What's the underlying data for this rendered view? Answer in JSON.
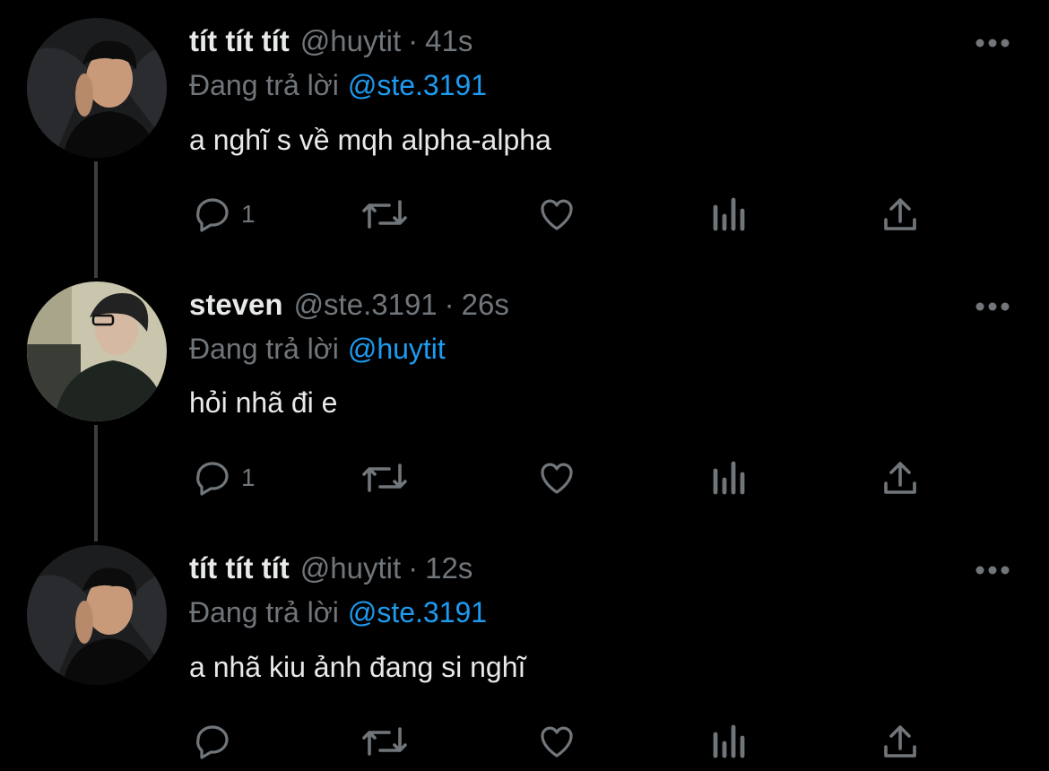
{
  "colors": {
    "background": "#000000",
    "text": "#e7e9ea",
    "muted": "#71767b",
    "mention": "#1d9bf0",
    "thread_line": "#3b3f43"
  },
  "reply_prefix": "Đang trả lời",
  "tweets": [
    {
      "name": "tít tít tít",
      "handle": "@huytit",
      "separator": "·",
      "time": "41s",
      "replying_to": "@ste.3191",
      "text": "a nghĩ s về mqh alpha-alpha",
      "reply_count": "1",
      "icons": [
        "reply-icon",
        "retweet-icon",
        "like-icon",
        "analytics-icon",
        "share-icon",
        "more-icon"
      ]
    },
    {
      "name": "steven",
      "handle": "@ste.3191",
      "separator": "·",
      "time": "26s",
      "replying_to": "@huytit",
      "text": "hỏi nhã đi e",
      "reply_count": "1",
      "icons": [
        "reply-icon",
        "retweet-icon",
        "like-icon",
        "analytics-icon",
        "share-icon",
        "more-icon"
      ]
    },
    {
      "name": "tít tít tít",
      "handle": "@huytit",
      "separator": "·",
      "time": "12s",
      "replying_to": "@ste.3191",
      "text": "a nhã kiu ảnh đang si nghĩ",
      "reply_count": "",
      "icons": [
        "reply-icon",
        "retweet-icon",
        "like-icon",
        "analytics-icon",
        "share-icon",
        "more-icon"
      ]
    }
  ]
}
